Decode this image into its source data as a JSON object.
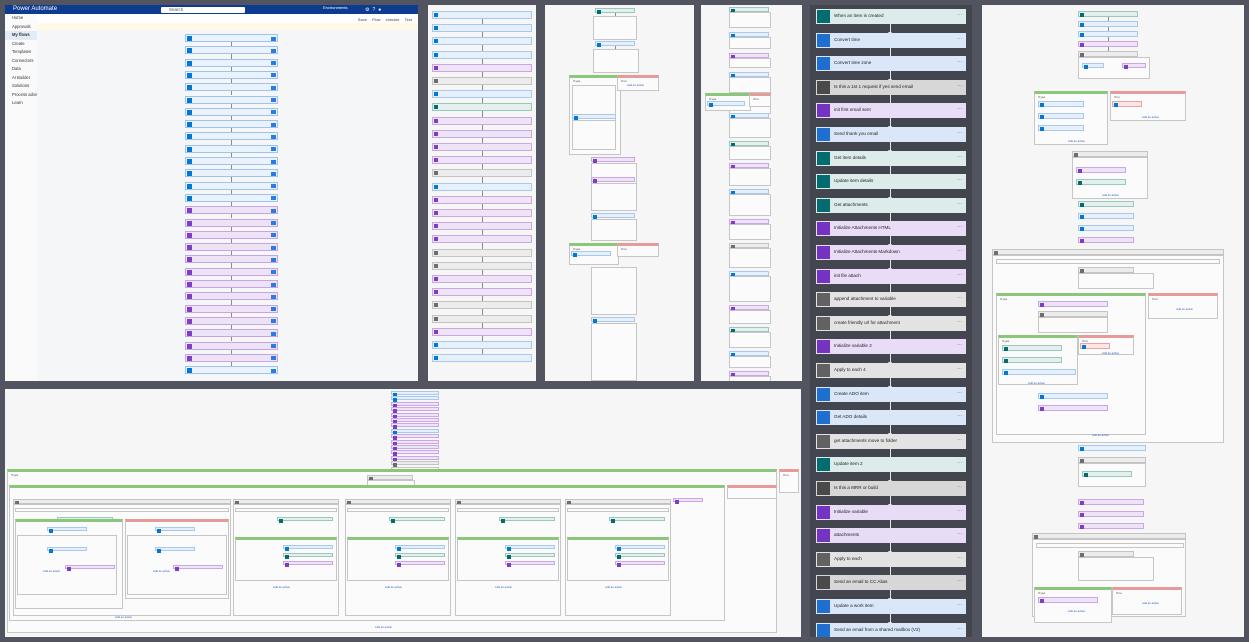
{
  "power_automate": {
    "app_name": "Power Automate",
    "search_placeholder": "Search",
    "environment": "Environments",
    "sidebar": [
      "Home",
      "Approvals",
      "My flows",
      "Create",
      "Templates",
      "Connectors",
      "Data",
      "AI Builder",
      "Solutions",
      "Process advisor",
      "Learn"
    ],
    "active_sidebar_index": 2,
    "breadcrumb": "",
    "commands": [
      "Save",
      "Flow checker",
      "Test"
    ],
    "notice": "",
    "steps": [
      {
        "label": "",
        "color": "blue"
      },
      {
        "label": "",
        "color": "blue"
      },
      {
        "label": "",
        "color": "blue"
      },
      {
        "label": "",
        "color": "blue"
      },
      {
        "label": "",
        "color": "blue"
      },
      {
        "label": "",
        "color": "blue"
      },
      {
        "label": "",
        "color": "blue"
      },
      {
        "label": "",
        "color": "blue"
      },
      {
        "label": "",
        "color": "blue"
      },
      {
        "label": "",
        "color": "blue"
      },
      {
        "label": "",
        "color": "blue"
      },
      {
        "label": "",
        "color": "blue"
      },
      {
        "label": "",
        "color": "blue"
      },
      {
        "label": "",
        "color": "blue"
      },
      {
        "label": "",
        "color": "purple"
      },
      {
        "label": "",
        "color": "purple"
      },
      {
        "label": "",
        "color": "purple"
      },
      {
        "label": "",
        "color": "purple"
      },
      {
        "label": "",
        "color": "purple"
      },
      {
        "label": "",
        "color": "purple"
      },
      {
        "label": "",
        "color": "purple"
      },
      {
        "label": "",
        "color": "purple"
      },
      {
        "label": "",
        "color": "purple"
      },
      {
        "label": "",
        "color": "purple"
      },
      {
        "label": "",
        "color": "purple"
      },
      {
        "label": "",
        "color": "purple"
      },
      {
        "label": "",
        "color": "purple"
      },
      {
        "label": "",
        "color": "blue"
      }
    ]
  },
  "condition": {
    "yes_label": "If yes",
    "no_label": "If no",
    "add_action": "Add an action"
  },
  "dark_flow": {
    "steps": [
      {
        "label": "When an item is created",
        "color": "teal",
        "icon": "sharepoint-icon"
      },
      {
        "label": "Convert time",
        "color": "blue",
        "icon": "clock-icon"
      },
      {
        "label": "Convert time zone",
        "color": "blue",
        "icon": "clock-icon"
      },
      {
        "label": "Is this a 1st 1 request if yes send email",
        "color": "dgray",
        "icon": "condition-icon"
      },
      {
        "label": "init first email sent",
        "color": "purple",
        "icon": "variable-icon"
      },
      {
        "label": "Send thank you email",
        "color": "blue",
        "icon": "outlook-icon"
      },
      {
        "label": "Get item details",
        "color": "teal",
        "icon": "sharepoint-icon"
      },
      {
        "label": "Update item details",
        "color": "teal",
        "icon": "sharepoint-icon"
      },
      {
        "label": "Get attachments",
        "color": "teal",
        "icon": "sharepoint-icon"
      },
      {
        "label": "Initialize Attachments HTML",
        "color": "purple",
        "icon": "variable-icon"
      },
      {
        "label": "Initialize Attachments Markdown",
        "color": "purple",
        "icon": "variable-icon"
      },
      {
        "label": "init file attach",
        "color": "purple",
        "icon": "variable-icon"
      },
      {
        "label": "append attachment to variable",
        "color": "gray",
        "icon": "loop-icon"
      },
      {
        "label": "create friendly url for attachment",
        "color": "gray",
        "icon": "loop-icon"
      },
      {
        "label": "Initialize variable 2",
        "color": "purple",
        "icon": "variable-icon"
      },
      {
        "label": "Apply to each 4",
        "color": "gray",
        "icon": "loop-icon"
      },
      {
        "label": "Create ADO item",
        "color": "blue",
        "icon": "devops-icon"
      },
      {
        "label": "Get ADO details",
        "color": "blue",
        "icon": "devops-icon"
      },
      {
        "label": "get attachments move to folder",
        "color": "gray",
        "icon": "loop-icon"
      },
      {
        "label": "Update item 2",
        "color": "teal",
        "icon": "sharepoint-icon"
      },
      {
        "label": "Is this a MRR or build",
        "color": "dgray",
        "icon": "condition-icon"
      },
      {
        "label": "Initialize variable",
        "color": "purple",
        "icon": "variable-icon"
      },
      {
        "label": "attachments",
        "color": "purple",
        "icon": "variable-icon"
      },
      {
        "label": "Apply to each",
        "color": "gray",
        "icon": "loop-icon"
      },
      {
        "label": "Send an email to CC Alias",
        "color": "dgray",
        "icon": "mail-icon"
      },
      {
        "label": "Update a work item",
        "color": "blue",
        "icon": "devops-icon"
      },
      {
        "label": "Send an email from a shared mailbox (V2)",
        "color": "blue",
        "icon": "outlook-icon"
      }
    ]
  }
}
